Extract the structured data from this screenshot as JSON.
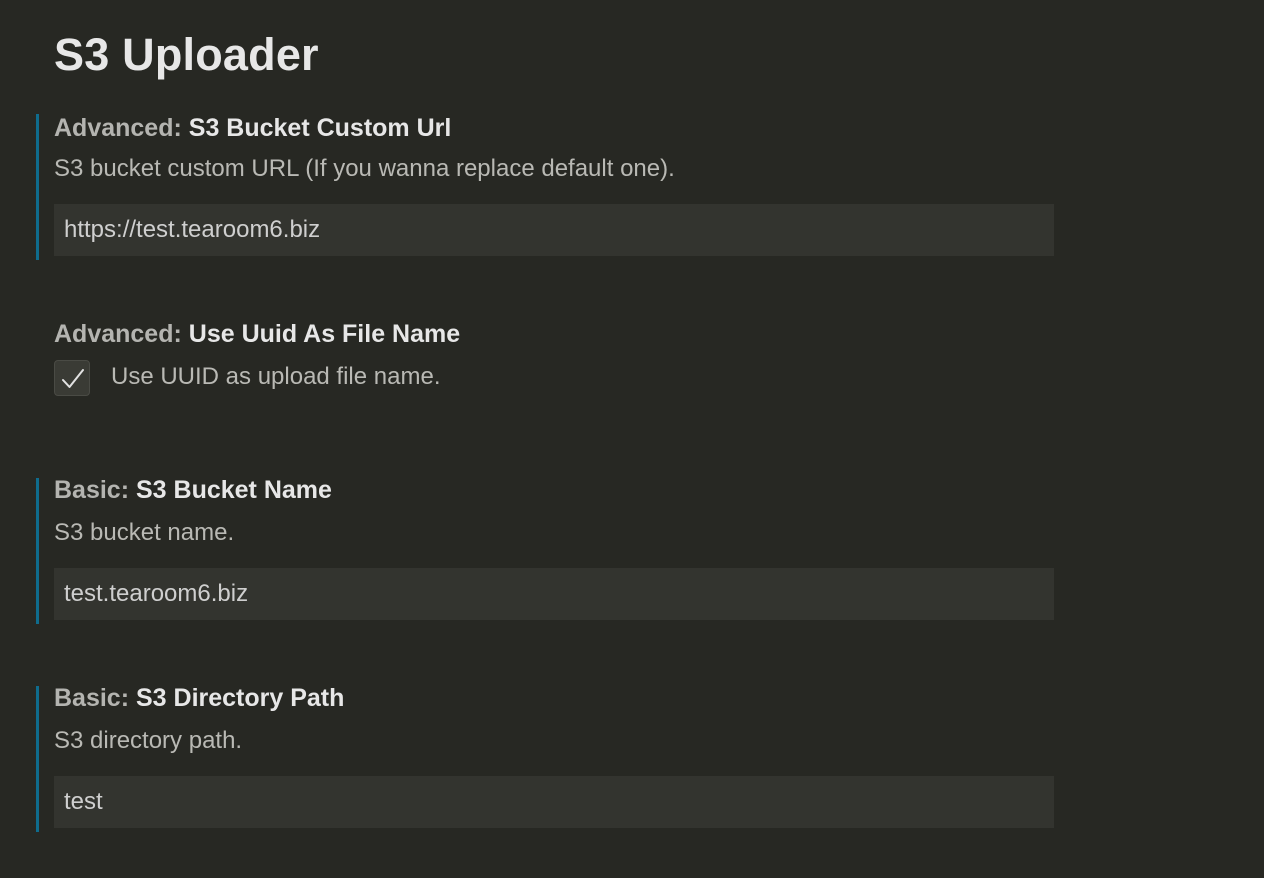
{
  "page": {
    "title": "S3 Uploader"
  },
  "settings": [
    {
      "category": "Advanced: ",
      "label": "S3 Bucket Custom Url",
      "description": "S3 bucket custom URL (If you wanna replace default one).",
      "value": "https://test.tearoom6.biz",
      "modified": true
    },
    {
      "category": "Advanced: ",
      "label": "Use Uuid As File Name",
      "description": "Use UUID as upload file name.",
      "checked": true,
      "checkbox_icon": "check-icon",
      "modified": false
    },
    {
      "category": "Basic: ",
      "label": "S3 Bucket Name",
      "description": "S3 bucket name.",
      "value": "test.tearoom6.biz",
      "modified": true
    },
    {
      "category": "Basic: ",
      "label": "S3 Directory Path",
      "description": "S3 directory path.",
      "value": "test",
      "modified": true
    }
  ],
  "colors": {
    "background": "#272823",
    "modified_indicator": "#0f6c8d",
    "input_background": "#33342f"
  }
}
